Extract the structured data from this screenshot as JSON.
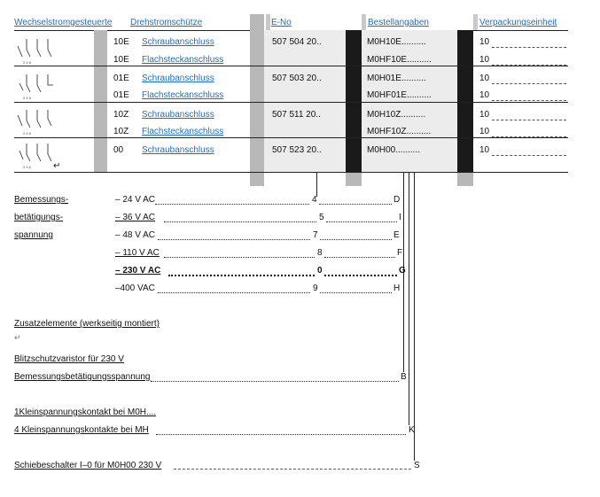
{
  "headers": {
    "col1": "Wechselstromgesteuerte",
    "col2": "Drehstromschütze",
    "col3": "E-No",
    "col4": "Bestellangaben",
    "col5": "Verpackungseinheit"
  },
  "rows": [
    {
      "code": "10E",
      "conn": "Schraubanschluss",
      "eno": "507 504 20..",
      "order": "M0H10E..........",
      "pack": "10"
    },
    {
      "code": "10E",
      "conn": "Flachsteckanschluss",
      "eno": "",
      "order": "M0HF10E..........",
      "pack": "10"
    },
    {
      "code": "01E",
      "conn": "Schraubanschluss",
      "eno": "507 503 20..",
      "order": "M0H01E..........",
      "pack": "10"
    },
    {
      "code": "01E",
      "conn": "Flachsteckanschluss",
      "eno": "",
      "order": "M0HF01E..........",
      "pack": "10"
    },
    {
      "code": "10Z",
      "conn": "Schraubanschluss",
      "eno": "507 511 20..",
      "order": "M0H10Z..........",
      "pack": "10"
    },
    {
      "code": "10Z",
      "conn": "Flachsteckanschluss",
      "eno": "",
      "order": "M0HF10Z..........",
      "pack": "10"
    },
    {
      "code": "00",
      "conn": "Schraubanschluss",
      "eno": "507 523 20..",
      "order": "M0H00..........",
      "pack": "10"
    }
  ],
  "voltage": {
    "label_lines": [
      "Bemessungs-",
      "betätigungs-",
      "spannung"
    ],
    "items": [
      {
        "v": "– 24 V AC",
        "eno": "4",
        "ord": "D",
        "bold": false
      },
      {
        "v": "– 36 V AC",
        "eno": "5",
        "ord": "I",
        "bold": false
      },
      {
        "v": "– 48 V AC",
        "eno": "7",
        "ord": "E",
        "bold": false
      },
      {
        "v": "– 110 V AC",
        "eno": "8",
        "ord": "F",
        "bold": false
      },
      {
        "v": "– 230 V AC",
        "eno": "0",
        "ord": "G",
        "bold": true
      },
      {
        "v": "–400 VAC",
        "eno": "9",
        "ord": "H",
        "bold": false
      }
    ]
  },
  "extras": {
    "title": "Zusatzelemente (werkseitig montiert)",
    "varistor": "Blitzschutzvaristor für 230 V",
    "varistor2": "Bemessungsbetätigungsspannung",
    "varistor_code": "B",
    "aux1": "1Kleinspannungskontakt bei M0H....",
    "aux4": "4 Kleinspannungskontakte bei MH",
    "aux4_code": "K",
    "switch": "Schiebeschalter I–0 für M0H00 230 V",
    "switch_code": "S"
  }
}
